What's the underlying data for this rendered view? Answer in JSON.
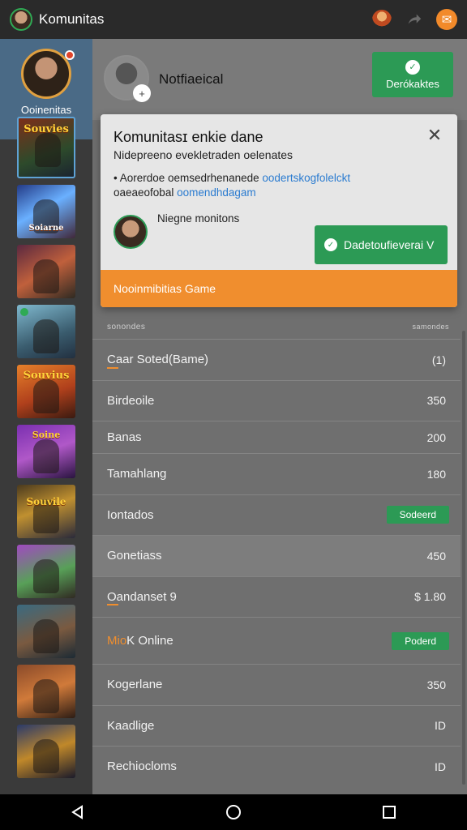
{
  "topbar": {
    "title": "Komunitas",
    "icons": [
      "app-avatar",
      "mascot-icon",
      "share-icon",
      "notification-icon"
    ]
  },
  "rail": {
    "user_label": "Ooinenitas",
    "games": [
      {
        "label": "Souvies"
      },
      {
        "label": "Soiarne"
      },
      {
        "label": ""
      },
      {
        "label": ""
      },
      {
        "label": "Souvius"
      },
      {
        "label": "Soine"
      },
      {
        "label": "Souvile"
      },
      {
        "label": ""
      },
      {
        "label": ""
      },
      {
        "label": ""
      },
      {
        "label": ""
      }
    ]
  },
  "header": {
    "title": "Notfiaeical",
    "button_label": "Derókaktes"
  },
  "popup": {
    "title": "Komunitasɪ enkie dane",
    "subtitle": "Nidepreeno evekletraden oelenates",
    "body_prefix": "• Aorerdoe oemsedrhenanede",
    "body_link1": "oodertskogfolelckt",
    "body_mid": "oaeaeofobal",
    "body_link2": "oomendhdagam",
    "user_name": "Niegne monitons",
    "button_label": "Dadetoufieverai V",
    "footer_label": "Nooinmibitias Game"
  },
  "list": {
    "header_left": "sonondes",
    "header_right": "samondes",
    "rows": [
      {
        "name": "Caar Soted(Bame)",
        "value": "(1)",
        "type": "text",
        "accent": true
      },
      {
        "name": "Birdeoile",
        "value": "350",
        "type": "text"
      },
      {
        "name": "Banas",
        "value": "200",
        "type": "text"
      },
      {
        "name": "Tamahlang",
        "value": "180",
        "type": "text"
      },
      {
        "name": "Iontados",
        "value": "Sodeerd",
        "type": "chip"
      },
      {
        "name": "Gonetiass",
        "value": "450",
        "type": "text",
        "highlight": true
      },
      {
        "name": "Oandanset 9",
        "value": "$ 1.80",
        "type": "text",
        "accent": true
      },
      {
        "name": "MioK Online",
        "value": "Poderd",
        "type": "chip",
        "orange_prefix": "Mio"
      },
      {
        "name": "Kogerlane",
        "value": "350",
        "type": "text"
      },
      {
        "name": "Kaadlige",
        "value": "ID",
        "type": "text"
      },
      {
        "name": "Rechiocloms",
        "value": "ID",
        "type": "text"
      }
    ]
  },
  "colors": {
    "accent_green": "#2c9a55",
    "accent_orange": "#f08e2e",
    "topbar": "#2a2a2a"
  }
}
